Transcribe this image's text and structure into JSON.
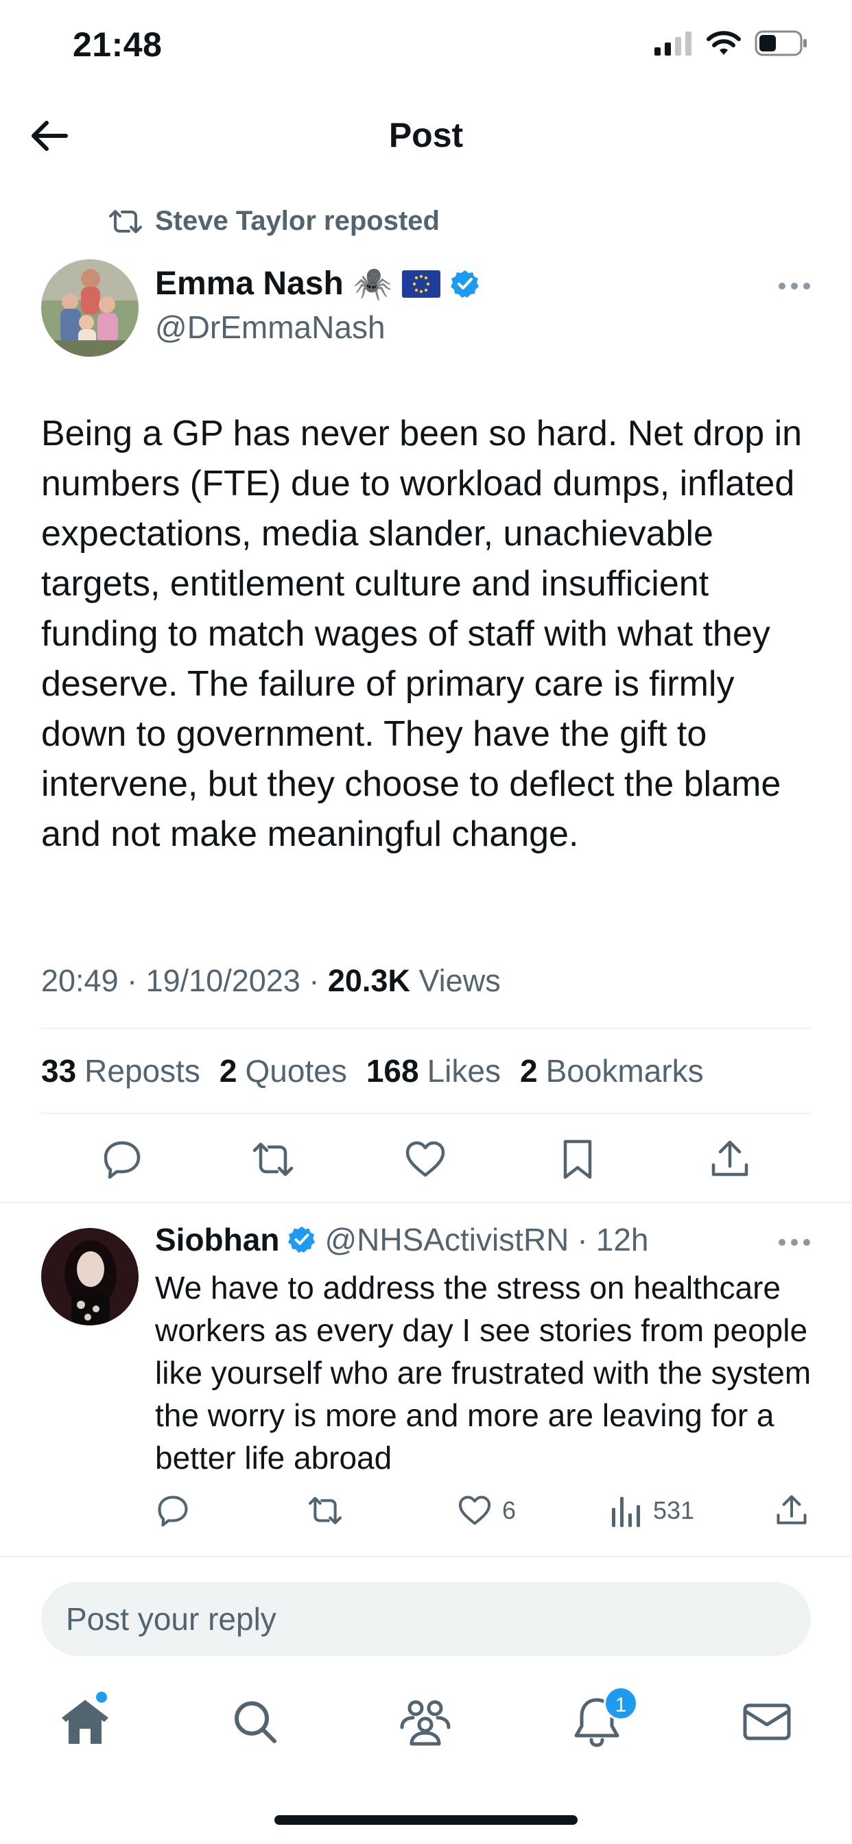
{
  "status_bar": {
    "time": "21:48"
  },
  "header": {
    "title": "Post"
  },
  "repost": {
    "label": "Steve Taylor reposted"
  },
  "tweet": {
    "author_name": "Emma Nash",
    "author_emoji": "🕷️",
    "author_handle": "@DrEmmaNash",
    "text": "Being a GP has never been so hard. Net drop in numbers (FTE) due to workload dumps, inflated expectations, media slander, unachievable targets, entitlement culture and insufficient funding to match wages of staff with what they deserve. The failure of primary care is firmly down to government. They have the gift to intervene, but they choose to deflect the blame and not make meaningful change.",
    "time": "20:49",
    "date": "19/10/2023",
    "views_count": "20.3K",
    "views_label": "Views",
    "reposts_count": "33",
    "reposts_label": "Reposts",
    "quotes_count": "2",
    "quotes_label": "Quotes",
    "likes_count": "168",
    "likes_label": "Likes",
    "bookmarks_count": "2",
    "bookmarks_label": "Bookmarks"
  },
  "reply": {
    "author_name": "Siobhan",
    "author_handle": "@NHSActivistRN",
    "time_ago": "12h",
    "text": "We have to address the stress on healthcare workers as every day I see stories from people like yourself who are frustrated with the system the worry is more and more are leaving for a better life abroad",
    "likes": "6",
    "views": "531"
  },
  "reply_input": {
    "placeholder": "Post your reply"
  },
  "tab_bar": {
    "notifications_badge": "1"
  },
  "colors": {
    "accent": "#1d9bf0",
    "text_primary": "#0f1419",
    "text_secondary": "#536471",
    "divider": "#eff3f4"
  }
}
